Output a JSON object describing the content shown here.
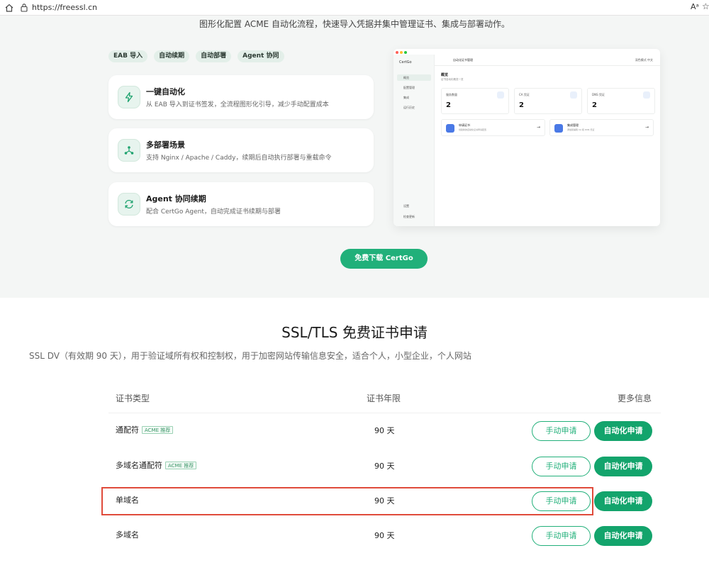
{
  "browser": {
    "url": "https://freessl.cn",
    "read_aloud_glyph": "Aᵃ",
    "favorite_glyph": "☆"
  },
  "hero": {
    "subtitle": "图形化配置 ACME 自动化流程，快速导入凭据并集中管理证书、集成与部署动作。",
    "chips": [
      "EAB 导入",
      "自动续期",
      "自动部署",
      "Agent 协同"
    ],
    "features": [
      {
        "title": "一键自动化",
        "desc": "从 EAB 导入到证书签发，全流程图形化引导，减少手动配置成本",
        "icon": "lightning-icon"
      },
      {
        "title": "多部署场景",
        "desc": "支持 Nginx / Apache / Caddy，续期后自动执行部署与重载命令",
        "icon": "network-icon"
      },
      {
        "title": "Agent 协同续期",
        "desc": "配合 CertGo Agent，自动完成证书续期与部署",
        "icon": "sync-icon"
      }
    ],
    "download_label": "免费下载 CertGo"
  },
  "mock": {
    "brand": "CertGo",
    "nav": [
      "概览",
      "配置管理",
      "集成",
      "运行历史"
    ],
    "bottom_nav": [
      "设置",
      "检查更新"
    ],
    "topbar_title": "自动化证书管理",
    "topbar_right": "深色模式   中文",
    "overview_title": "概览",
    "overview_sub": "证书自动化概览一览",
    "stats": [
      {
        "label": "服务数量",
        "value": "2"
      },
      {
        "label": "CA 凭证",
        "value": "2"
      },
      {
        "label": "DNS 凭证",
        "value": "2"
      }
    ],
    "actions": [
      {
        "title": "申请证书",
        "desc": "创建新的自动化证书申请配置"
      },
      {
        "title": "集成管理",
        "desc": "添加和编辑 CA 和 DNS 凭证"
      }
    ],
    "dot_colors": [
      "#ff5f57",
      "#febc2e",
      "#28c840"
    ]
  },
  "section": {
    "title": "SSL/TLS 免费证书申请",
    "subtitle": "SSL DV（有效期 90 天），用于验证域所有权和控制权，用于加密网站传输信息安全，适合个人，小型企业，个人网站"
  },
  "table": {
    "headers": [
      "证书类型",
      "证书年限",
      "更多信息"
    ],
    "rows": [
      {
        "name": "通配符",
        "badge": "ACME 推荐",
        "term": "90 天",
        "manual": "手动申请",
        "auto": "自动化申请"
      },
      {
        "name": "多域名通配符",
        "badge": "ACME 推荐",
        "term": "90 天",
        "manual": "手动申请",
        "auto": "自动化申请"
      },
      {
        "name": "单域名",
        "badge": "",
        "term": "90 天",
        "manual": "手动申请",
        "auto": "自动化申请"
      },
      {
        "name": "多域名",
        "badge": "",
        "term": "90 天",
        "manual": "手动申请",
        "auto": "自动化申请"
      }
    ]
  },
  "colors": {
    "brand_green": "#21b07a",
    "highlight_red": "#e04b3b"
  }
}
